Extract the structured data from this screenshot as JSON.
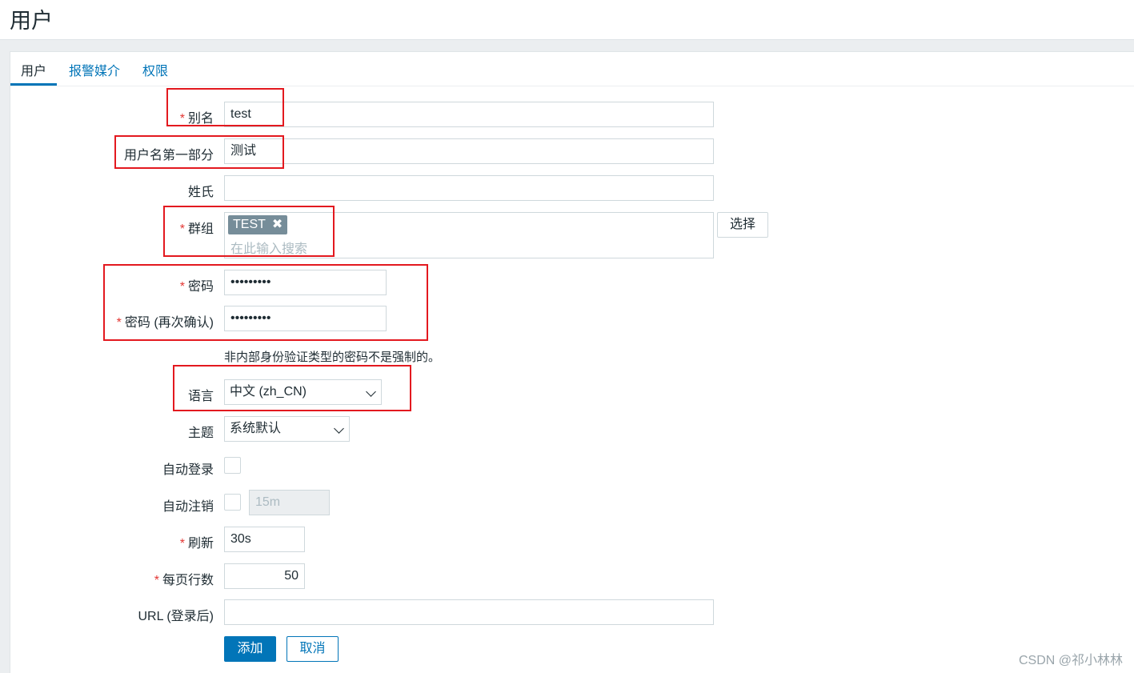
{
  "page": {
    "title": "用户"
  },
  "tabs": [
    {
      "label": "用户"
    },
    {
      "label": "报警媒介"
    },
    {
      "label": "权限"
    }
  ],
  "required_mark": "*",
  "form": {
    "alias": {
      "label": "别名",
      "value": "test"
    },
    "name": {
      "label": "用户名第一部分",
      "value": "测试"
    },
    "surname": {
      "label": "姓氏",
      "value": ""
    },
    "groups": {
      "label": "群组",
      "chip": "TEST",
      "chip_remove": "✖",
      "placeholder": "在此输入搜索",
      "select_button": "选择"
    },
    "password": {
      "label": "密码",
      "value": "•••••••••"
    },
    "password_confirm": {
      "label": "密码 (再次确认)",
      "value": "•••••••••"
    },
    "password_hint": "非内部身份验证类型的密码不是强制的。",
    "language": {
      "label": "语言",
      "value": "中文 (zh_CN)"
    },
    "theme": {
      "label": "主题",
      "value": "系统默认"
    },
    "autologin": {
      "label": "自动登录"
    },
    "autologout": {
      "label": "自动注销",
      "value": "15m"
    },
    "refresh": {
      "label": "刷新",
      "value": "30s"
    },
    "rows_per_page": {
      "label": "每页行数",
      "value": "50"
    },
    "url": {
      "label": "URL (登录后)",
      "value": ""
    }
  },
  "buttons": {
    "add": "添加",
    "cancel": "取消"
  },
  "watermark": "CSDN @祁小林林",
  "colors": {
    "accent": "#0275b8",
    "required": "#e33734",
    "highlight_box": "#e3191f",
    "chip": "#768d99"
  }
}
